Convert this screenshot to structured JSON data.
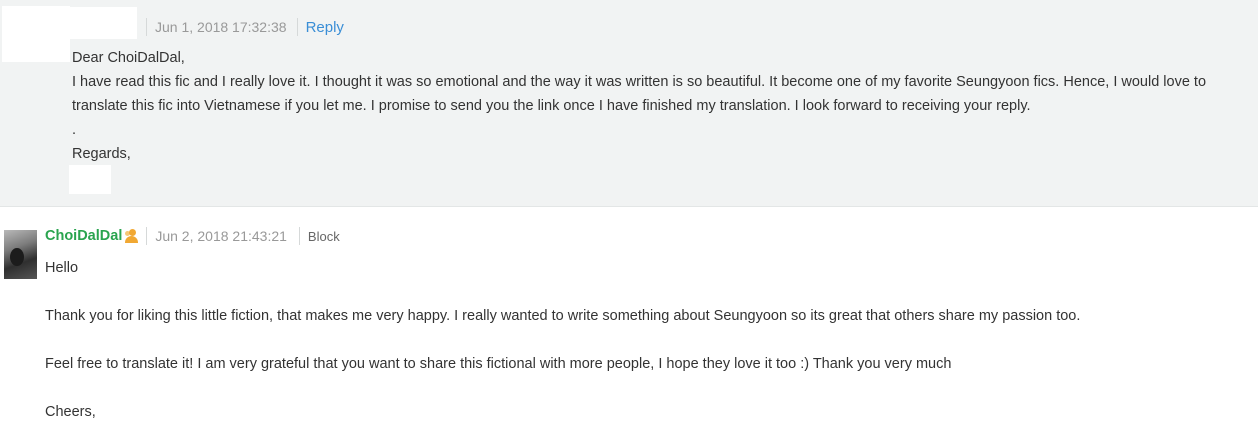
{
  "comment_1": {
    "timestamp": "Jun 1, 2018 17:32:38",
    "reply_label": "Reply",
    "lines": [
      "Dear ChoiDalDal,",
      "I have read this fic and I really love it. I thought it was so emotional and the way it was written is so beautiful. It become one of my favorite Seungyoon fics. Hence, I would love to",
      "translate this fic into Vietnamese if you let me. I promise to send you the link once I have finished my translation. I look forward to receiving your reply.",
      ".",
      "Regards,"
    ]
  },
  "comment_2": {
    "username": "ChoiDalDal",
    "author_icon": "user-pair-icon",
    "timestamp": "Jun 2, 2018 21:43:21",
    "block_label": "Block",
    "paragraphs": [
      "Hello",
      "Thank you for liking this little fiction, that makes me very happy. I really wanted to write something about Seungyoon so its great that others share my passion too.",
      "Feel free to translate it! I am very grateful that you want to share this fictional with more people, I hope they love it too :) Thank you very much",
      "Cheers,"
    ]
  },
  "colors": {
    "username": "#2aa44f",
    "link": "#3a8ed6",
    "panel_bg": "#f1f3f3",
    "icon_accent": "#f1a833"
  }
}
